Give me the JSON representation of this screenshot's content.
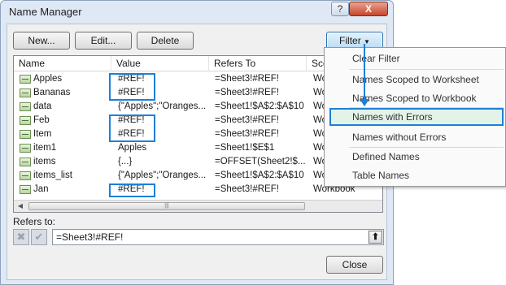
{
  "window": {
    "title": "Name Manager",
    "help_label": "?",
    "close_label": "X"
  },
  "toolbar": {
    "new_label": "New...",
    "edit_label": "Edit...",
    "delete_label": "Delete",
    "filter_label": "Filter"
  },
  "grid": {
    "columns": [
      "Name",
      "Value",
      "Refers To",
      "Scope"
    ],
    "rows": [
      {
        "name": "Apples",
        "value": "#REF!",
        "refers": "=Sheet3!#REF!",
        "scope": "Workbook"
      },
      {
        "name": "Bananas",
        "value": "#REF!",
        "refers": "=Sheet3!#REF!",
        "scope": "Workbook"
      },
      {
        "name": "data",
        "value": "{\"Apples\";\"Oranges...",
        "refers": "=Sheet1!$A$2:$A$10",
        "scope": "Workbook"
      },
      {
        "name": "Feb",
        "value": "#REF!",
        "refers": "=Sheet3!#REF!",
        "scope": "Workbook"
      },
      {
        "name": "Item",
        "value": "#REF!",
        "refers": "=Sheet3!#REF!",
        "scope": "Workbook"
      },
      {
        "name": "item1",
        "value": "Apples",
        "refers": "=Sheet1!$E$1",
        "scope": "Workbook"
      },
      {
        "name": "items",
        "value": "{...}",
        "refers": "=OFFSET(Sheet2!$...",
        "scope": "Workbook"
      },
      {
        "name": "items_list",
        "value": "{\"Apples\";\"Oranges...",
        "refers": "=Sheet1!$A$2:$A$10",
        "scope": "Workbook"
      },
      {
        "name": "Jan",
        "value": "#REF!",
        "refers": "=Sheet3!#REF!",
        "scope": "Workbook"
      }
    ]
  },
  "refers_to": {
    "label": "Refers to:",
    "value": "=Sheet3!#REF!"
  },
  "close_button_label": "Close",
  "filter_menu": {
    "items": [
      "Clear Filter",
      "Names Scoped to Worksheet",
      "Names Scoped to Workbook",
      "Names with Errors",
      "Names without Errors",
      "Defined Names",
      "Table Names"
    ],
    "selected": "Names with Errors"
  },
  "colors": {
    "highlight": "#1d7fd8",
    "selected_item_bg": "#e3f3e8"
  }
}
